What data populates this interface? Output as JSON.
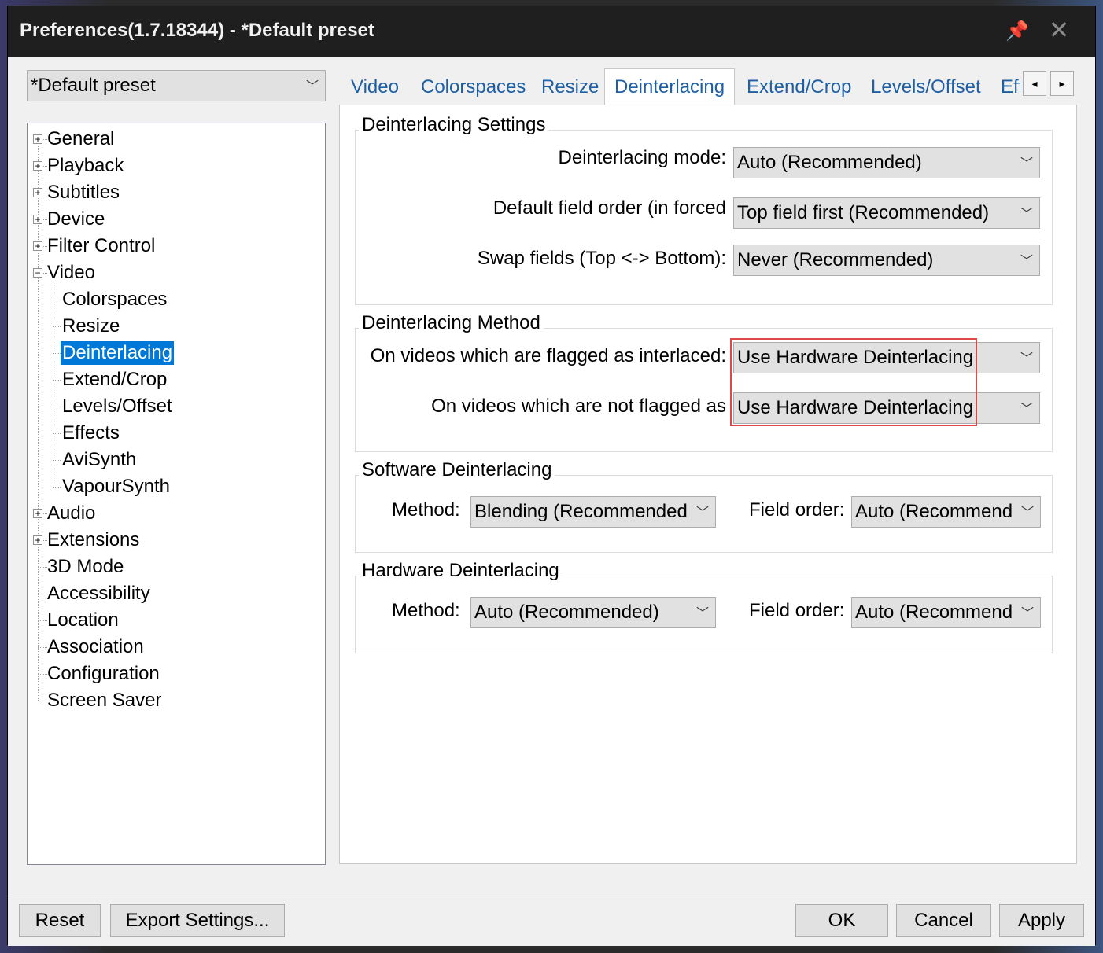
{
  "window": {
    "title": "Preferences(1.7.18344) - *Default preset"
  },
  "preset": {
    "value": "*Default preset"
  },
  "tree": [
    {
      "label": "General",
      "level": 0,
      "expander": "+"
    },
    {
      "label": "Playback",
      "level": 0,
      "expander": "+"
    },
    {
      "label": "Subtitles",
      "level": 0,
      "expander": "+"
    },
    {
      "label": "Device",
      "level": 0,
      "expander": "+"
    },
    {
      "label": "Filter Control",
      "level": 0,
      "expander": "+"
    },
    {
      "label": "Video",
      "level": 0,
      "expander": "−"
    },
    {
      "label": "Colorspaces",
      "level": 1
    },
    {
      "label": "Resize",
      "level": 1
    },
    {
      "label": "Deinterlacing",
      "level": 1,
      "selected": true
    },
    {
      "label": "Extend/Crop",
      "level": 1
    },
    {
      "label": "Levels/Offset",
      "level": 1
    },
    {
      "label": "Effects",
      "level": 1
    },
    {
      "label": "AviSynth",
      "level": 1
    },
    {
      "label": "VapourSynth",
      "level": 1
    },
    {
      "label": "Audio",
      "level": 0,
      "expander": "+"
    },
    {
      "label": "Extensions",
      "level": 0,
      "expander": "+"
    },
    {
      "label": "3D Mode",
      "level": 0
    },
    {
      "label": "Accessibility",
      "level": 0
    },
    {
      "label": "Location",
      "level": 0
    },
    {
      "label": "Association",
      "level": 0
    },
    {
      "label": "Configuration",
      "level": 0
    },
    {
      "label": "Screen Saver",
      "level": 0
    }
  ],
  "tabs": [
    "Video",
    "Colorspaces",
    "Resize",
    "Deinterlacing",
    "Extend/Crop",
    "Levels/Offset",
    "Eff"
  ],
  "active_tab": "Deinterlacing",
  "tab_scroll": {
    "left": "◂",
    "right": "▸"
  },
  "settings": {
    "title": "Deinterlacing Settings",
    "mode_label": "Deinterlacing mode:",
    "mode_value": "Auto (Recommended)",
    "field_label": "Default field order (in forced",
    "field_value": "Top field first (Recommended)",
    "swap_label": "Swap fields (Top <-> Bottom):",
    "swap_value": "Never (Recommended)"
  },
  "method": {
    "title": "Deinterlacing Method",
    "flagged_label": "On videos which are flagged as interlaced:",
    "flagged_value": "Use Hardware Deinterlacing",
    "notflagged_label": "On videos which are not flagged as",
    "notflagged_value": "Use Hardware Deinterlacing"
  },
  "software": {
    "title": "Software Deinterlacing",
    "method_label": "Method:",
    "method_value": "Blending (Recommended",
    "field_label": "Field order:",
    "field_value": "Auto (Recommend"
  },
  "hardware": {
    "title": "Hardware Deinterlacing",
    "method_label": "Method:",
    "method_value": "Auto (Recommended)",
    "field_label": "Field order:",
    "field_value": "Auto (Recommend"
  },
  "buttons": {
    "reset": "Reset",
    "export": "Export Settings...",
    "ok": "OK",
    "cancel": "Cancel",
    "apply": "Apply"
  },
  "colors": {
    "accent": "#0078d7",
    "highlight": "#e04848",
    "tab_text": "#1f5fa3"
  }
}
